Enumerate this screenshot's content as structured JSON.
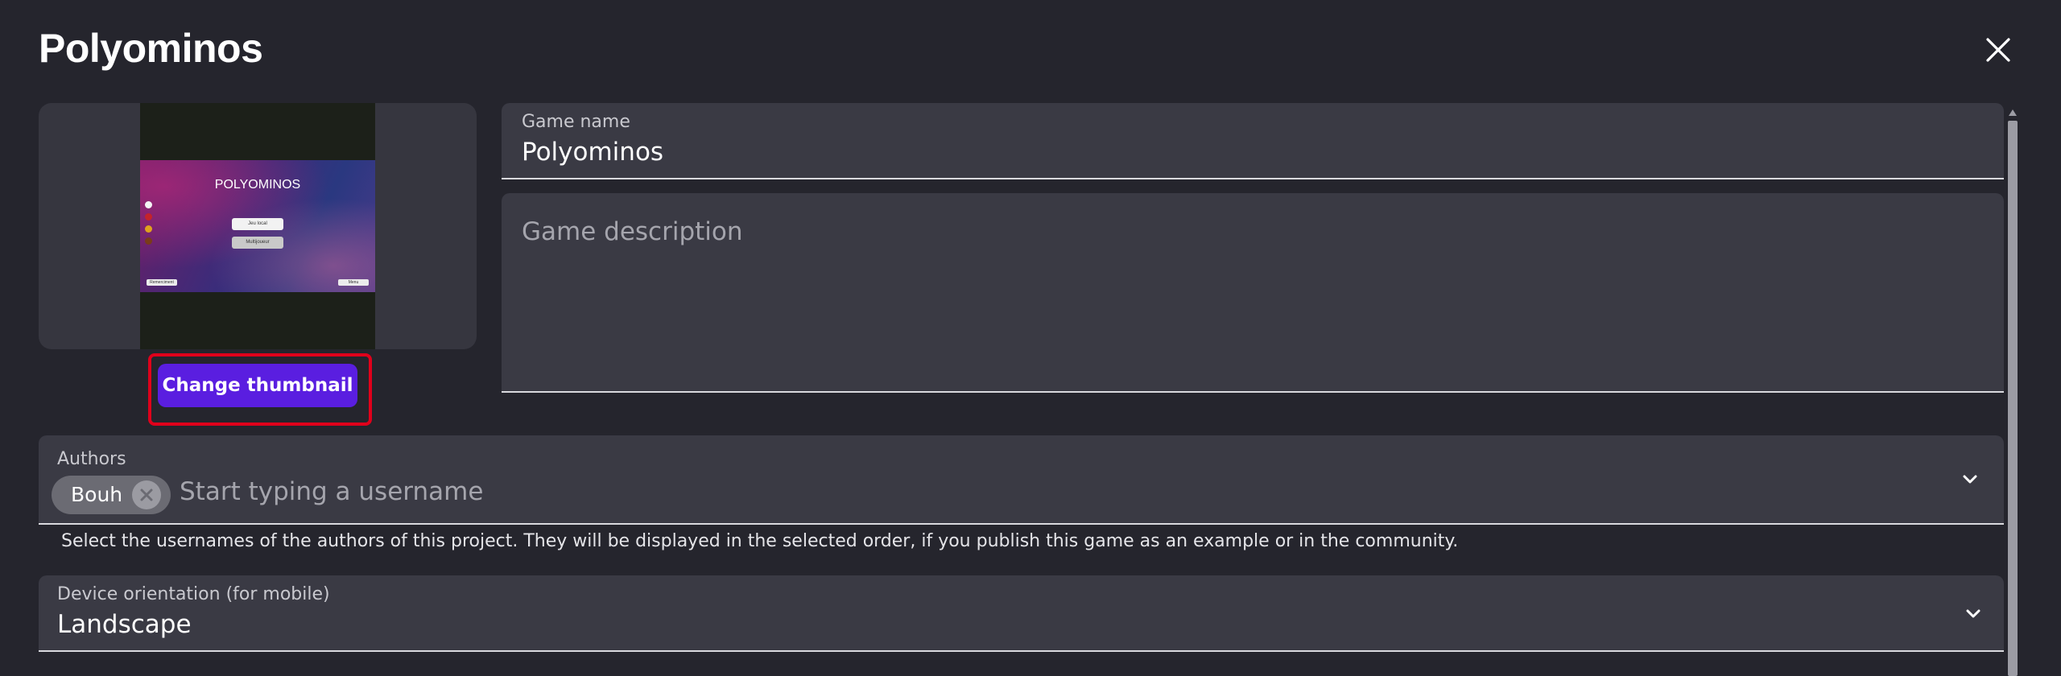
{
  "dialog": {
    "title": "Polyominos"
  },
  "thumbnail": {
    "game_title": "POLYOMINOS",
    "buttons": [
      "Jeu local",
      "Multijoueur"
    ],
    "corner_buttons": [
      "Remerciment",
      "Menu"
    ],
    "change_button_label": "Change thumbnail"
  },
  "game_name": {
    "label": "Game name",
    "value": "Polyominos"
  },
  "game_description": {
    "placeholder": "Game description",
    "value": ""
  },
  "authors": {
    "label": "Authors",
    "chips": [
      "Bouh"
    ],
    "placeholder": "Start typing a username",
    "helper_text": "Select the usernames of the authors of this project. They will be displayed in the selected order, if you publish this game as an example or in the community."
  },
  "orientation": {
    "label": "Device orientation (for mobile)",
    "value": "Landscape"
  },
  "icons": {
    "close": "close-icon",
    "chip_remove": "cancel-circle-icon",
    "dropdown": "chevron-down-icon"
  },
  "colors": {
    "background": "#25252d",
    "field_background": "#3a3a44",
    "primary_button": "#5a1ee0",
    "highlight": "#e0001b"
  }
}
